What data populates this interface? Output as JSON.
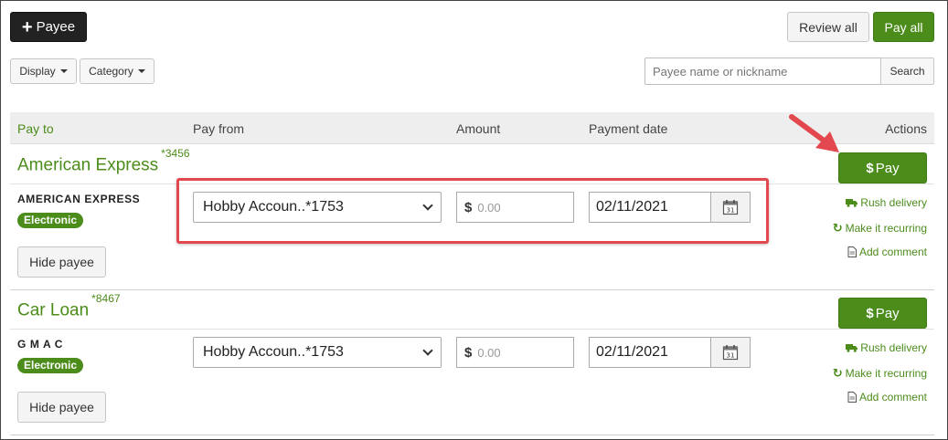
{
  "toolbar": {
    "add_payee_label": "Payee",
    "review_all_label": "Review all",
    "pay_all_label": "Pay all",
    "display_label": "Display",
    "category_label": "Category",
    "search_placeholder": "Payee name or nickname",
    "search_label": "Search"
  },
  "table": {
    "headers": {
      "pay_to": "Pay to",
      "pay_from": "Pay from",
      "amount": "Amount",
      "payment_date": "Payment date",
      "actions": "Actions"
    }
  },
  "payees": [
    {
      "name": "American Express",
      "account_suffix": "*3456",
      "company": "AMERICAN EXPRESS",
      "badge": "Electronic",
      "pay_from": "Hobby Accoun..*1753",
      "currency": "$",
      "amount_placeholder": "0.00",
      "payment_date": "02/11/2021",
      "pay_label": "Pay",
      "pay_icon": "$",
      "rush_delivery": "Rush delivery",
      "make_recurring": "Make it recurring",
      "add_comment": "Add comment",
      "hide_label": "Hide payee"
    },
    {
      "name": "Car Loan",
      "account_suffix": "*8467",
      "company": "G M A C",
      "badge": "Electronic",
      "pay_from": "Hobby Accoun..*1753",
      "currency": "$",
      "amount_placeholder": "0.00",
      "payment_date": "02/11/2021",
      "pay_label": "Pay",
      "pay_icon": "$",
      "rush_delivery": "Rush delivery",
      "make_recurring": "Make it recurring",
      "add_comment": "Add comment",
      "hide_label": "Hide payee"
    }
  ],
  "colors": {
    "accent_green": "#4b8c1b",
    "highlight_red": "#e2484d"
  },
  "icons": {
    "add": "plus-icon",
    "calendar": "calendar-icon",
    "truck": "truck-icon",
    "recurring": "refresh-icon",
    "comment": "document-icon"
  }
}
